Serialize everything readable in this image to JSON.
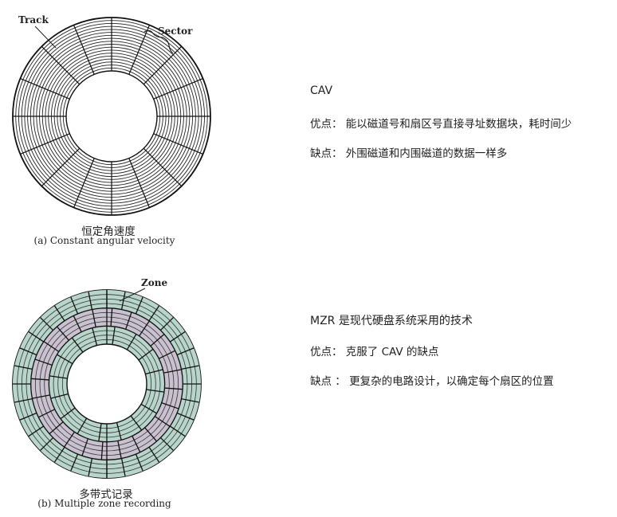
{
  "cav": {
    "track_label": "Track",
    "sector_label": "Sector",
    "caption_cn": "恒定角速度",
    "caption_en": "(a) Constant angular velocity",
    "tracks": 18,
    "sectors": 16
  },
  "mzr": {
    "zone_label": "Zone",
    "caption_cn": "多带式记录",
    "caption_en": "(b) Multiple zone recording",
    "tracks": 12,
    "zones": [
      {
        "sectors": 32
      },
      {
        "sectors": 24
      },
      {
        "sectors": 16
      }
    ],
    "colors": {
      "zone_a": "#b7d5cb",
      "zone_b": "#c9c1cf"
    }
  },
  "notes": {
    "cav_title": "CAV",
    "cav_pro": "优点： 能以磁道号和扇区号直接寻址数据块，耗时间少",
    "cav_con": "缺点： 外围磁道和内围磁道的数据一样多",
    "mzr_title": "MZR  是现代硬盘系统采用的技术",
    "mzr_pro": "优点： 克服了 CAV 的缺点",
    "mzr_con": "缺点  ：  更复杂的电路设计，以确定每个扇区的位置"
  }
}
